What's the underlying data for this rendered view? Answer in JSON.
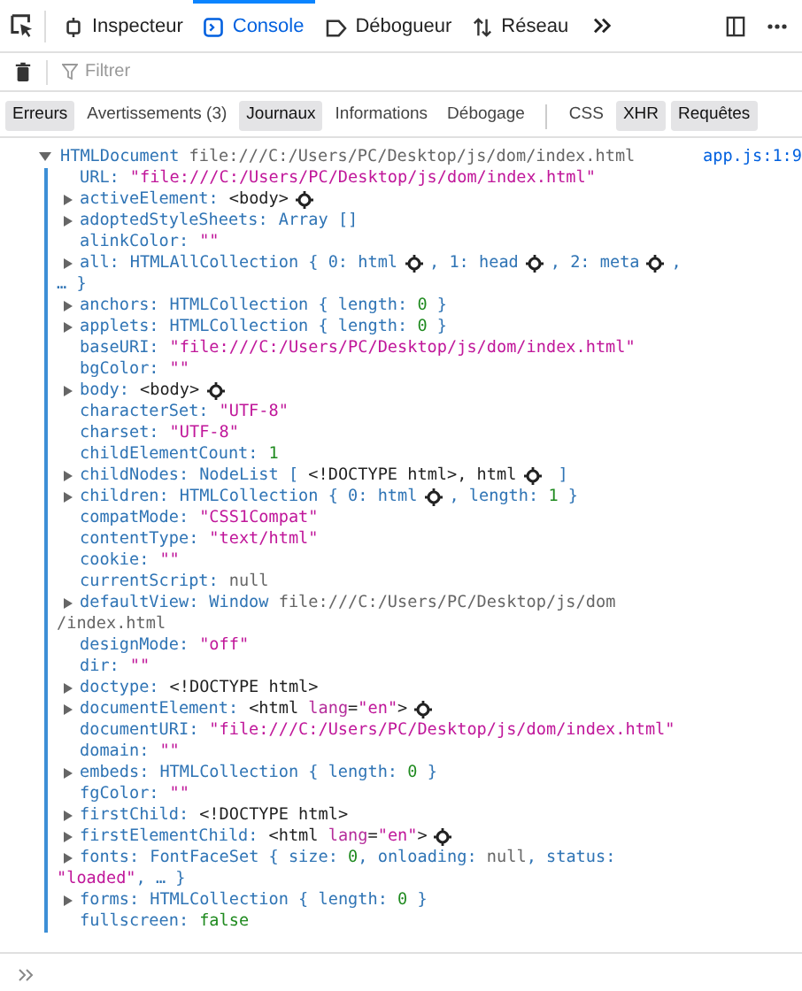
{
  "toolbar": {
    "tabs": [
      {
        "label": "Inspecteur",
        "selected": false
      },
      {
        "label": "Console",
        "selected": true
      },
      {
        "label": "Débogueur",
        "selected": false
      },
      {
        "label": "Réseau",
        "selected": false
      }
    ]
  },
  "filter": {
    "placeholder": "Filtrer"
  },
  "filter_groups": [
    {
      "buttons": [
        {
          "label": "Erreurs",
          "selected": true
        },
        {
          "label": "Avertissements (3)",
          "selected": false
        },
        {
          "label": "Journaux",
          "selected": true
        },
        {
          "label": "Informations",
          "selected": false
        },
        {
          "label": "Débogage",
          "selected": false
        }
      ]
    },
    {
      "buttons": [
        {
          "label": "CSS",
          "selected": false
        },
        {
          "label": "XHR",
          "selected": true
        },
        {
          "label": "Requêtes",
          "selected": true
        }
      ]
    }
  ],
  "log": {
    "type": "HTMLDocument",
    "location": "file:///C:/Users/PC/Desktop/js/dom/index.html",
    "source": "app.js:1:9",
    "expanded": true,
    "properties": [
      {
        "key": "URL:",
        "expandable": false,
        "value": [
          {
            "kind": "string",
            "text": "\"file:///C:/Users/PC/Desktop/js/dom/index.html\""
          }
        ]
      },
      {
        "key": "activeElement:",
        "expandable": true,
        "value": [
          {
            "kind": "tag",
            "text": "<body>"
          },
          {
            "kind": "gear"
          }
        ]
      },
      {
        "key": "adoptedStyleSheets:",
        "expandable": true,
        "value": [
          {
            "kind": "type",
            "text": "Array []"
          }
        ]
      },
      {
        "key": "alinkColor:",
        "expandable": false,
        "value": [
          {
            "kind": "string",
            "text": "\"\""
          }
        ]
      },
      {
        "key": "all:",
        "expandable": true,
        "value": [
          {
            "kind": "type",
            "text": "HTMLAllCollection { 0: html"
          },
          {
            "kind": "gear"
          },
          {
            "kind": "type",
            "text": ", 1: head"
          },
          {
            "kind": "gear"
          },
          {
            "kind": "type",
            "text": ", 2: meta"
          },
          {
            "kind": "gear"
          },
          {
            "kind": "type",
            "text": ","
          }
        ],
        "continuation": [
          {
            "kind": "type",
            "text": "… }"
          }
        ]
      },
      {
        "key": "anchors:",
        "expandable": true,
        "value": [
          {
            "kind": "type",
            "text": "HTMLCollection { length: "
          },
          {
            "kind": "number",
            "text": "0"
          },
          {
            "kind": "type",
            "text": " }"
          }
        ]
      },
      {
        "key": "applets:",
        "expandable": true,
        "value": [
          {
            "kind": "type",
            "text": "HTMLCollection { length: "
          },
          {
            "kind": "number",
            "text": "0"
          },
          {
            "kind": "type",
            "text": " }"
          }
        ]
      },
      {
        "key": "baseURI:",
        "expandable": false,
        "value": [
          {
            "kind": "string",
            "text": "\"file:///C:/Users/PC/Desktop/js/dom/index.html\""
          }
        ]
      },
      {
        "key": "bgColor:",
        "expandable": false,
        "value": [
          {
            "kind": "string",
            "text": "\"\""
          }
        ]
      },
      {
        "key": "body:",
        "expandable": true,
        "value": [
          {
            "kind": "tag",
            "text": "<body>"
          },
          {
            "kind": "gear"
          }
        ]
      },
      {
        "key": "characterSet:",
        "expandable": false,
        "value": [
          {
            "kind": "string",
            "text": "\"UTF-8\""
          }
        ]
      },
      {
        "key": "charset:",
        "expandable": false,
        "value": [
          {
            "kind": "string",
            "text": "\"UTF-8\""
          }
        ]
      },
      {
        "key": "childElementCount:",
        "expandable": false,
        "value": [
          {
            "kind": "number",
            "text": "1"
          }
        ]
      },
      {
        "key": "childNodes:",
        "expandable": true,
        "value": [
          {
            "kind": "type",
            "text": "NodeList [ "
          },
          {
            "kind": "tag",
            "text": "<!DOCTYPE html>, html"
          },
          {
            "kind": "gear"
          },
          {
            "kind": "type",
            "text": " ]"
          }
        ]
      },
      {
        "key": "children:",
        "expandable": true,
        "value": [
          {
            "kind": "type",
            "text": "HTMLCollection { 0: html"
          },
          {
            "kind": "gear"
          },
          {
            "kind": "type",
            "text": ", length: "
          },
          {
            "kind": "number",
            "text": "1"
          },
          {
            "kind": "type",
            "text": " }"
          }
        ]
      },
      {
        "key": "compatMode:",
        "expandable": false,
        "value": [
          {
            "kind": "string",
            "text": "\"CSS1Compat\""
          }
        ]
      },
      {
        "key": "contentType:",
        "expandable": false,
        "value": [
          {
            "kind": "string",
            "text": "\"text/html\""
          }
        ]
      },
      {
        "key": "cookie:",
        "expandable": false,
        "value": [
          {
            "kind": "string",
            "text": "\"\""
          }
        ]
      },
      {
        "key": "currentScript:",
        "expandable": false,
        "value": [
          {
            "kind": "plain",
            "text": "null"
          }
        ]
      },
      {
        "key": "defaultView:",
        "expandable": true,
        "value": [
          {
            "kind": "type",
            "text": "Window"
          },
          {
            "kind": "plain",
            "text": " file:///C:/Users/PC/Desktop/js/dom"
          }
        ],
        "continuation": [
          {
            "kind": "plain",
            "text": "/index.html"
          }
        ]
      },
      {
        "key": "designMode:",
        "expandable": false,
        "value": [
          {
            "kind": "string",
            "text": "\"off\""
          }
        ]
      },
      {
        "key": "dir:",
        "expandable": false,
        "value": [
          {
            "kind": "string",
            "text": "\"\""
          }
        ]
      },
      {
        "key": "doctype:",
        "expandable": true,
        "value": [
          {
            "kind": "tag",
            "text": "<!DOCTYPE html>"
          }
        ]
      },
      {
        "key": "documentElement:",
        "expandable": true,
        "value": [
          {
            "kind": "tag",
            "text": "<html "
          },
          {
            "kind": "attr",
            "text": "lang"
          },
          {
            "kind": "tag",
            "text": "="
          },
          {
            "kind": "string",
            "text": "\"en\""
          },
          {
            "kind": "tag",
            "text": ">"
          },
          {
            "kind": "gear"
          }
        ]
      },
      {
        "key": "documentURI:",
        "expandable": false,
        "value": [
          {
            "kind": "string",
            "text": "\"file:///C:/Users/PC/Desktop/js/dom/index.html\""
          }
        ]
      },
      {
        "key": "domain:",
        "expandable": false,
        "value": [
          {
            "kind": "string",
            "text": "\"\""
          }
        ]
      },
      {
        "key": "embeds:",
        "expandable": true,
        "value": [
          {
            "kind": "type",
            "text": "HTMLCollection { length: "
          },
          {
            "kind": "number",
            "text": "0"
          },
          {
            "kind": "type",
            "text": " }"
          }
        ]
      },
      {
        "key": "fgColor:",
        "expandable": false,
        "value": [
          {
            "kind": "string",
            "text": "\"\""
          }
        ]
      },
      {
        "key": "firstChild:",
        "expandable": true,
        "value": [
          {
            "kind": "tag",
            "text": "<!DOCTYPE html>"
          }
        ]
      },
      {
        "key": "firstElementChild:",
        "expandable": true,
        "value": [
          {
            "kind": "tag",
            "text": "<html "
          },
          {
            "kind": "attr",
            "text": "lang"
          },
          {
            "kind": "tag",
            "text": "="
          },
          {
            "kind": "string",
            "text": "\"en\""
          },
          {
            "kind": "tag",
            "text": ">"
          },
          {
            "kind": "gear"
          }
        ]
      },
      {
        "key": "fonts:",
        "expandable": true,
        "value": [
          {
            "kind": "type",
            "text": "FontFaceSet { size: "
          },
          {
            "kind": "number",
            "text": "0"
          },
          {
            "kind": "type",
            "text": ", onloading: "
          },
          {
            "kind": "plain",
            "text": "null"
          },
          {
            "kind": "type",
            "text": ", status:"
          }
        ],
        "continuation": [
          {
            "kind": "string",
            "text": "\"loaded\""
          },
          {
            "kind": "type",
            "text": ", … }"
          }
        ]
      },
      {
        "key": "forms:",
        "expandable": true,
        "value": [
          {
            "kind": "type",
            "text": "HTMLCollection { length: "
          },
          {
            "kind": "number",
            "text": "0"
          },
          {
            "kind": "type",
            "text": " }"
          }
        ]
      },
      {
        "key": "fullscreen:",
        "expandable": false,
        "value": [
          {
            "kind": "number",
            "text": "false"
          }
        ]
      }
    ]
  }
}
